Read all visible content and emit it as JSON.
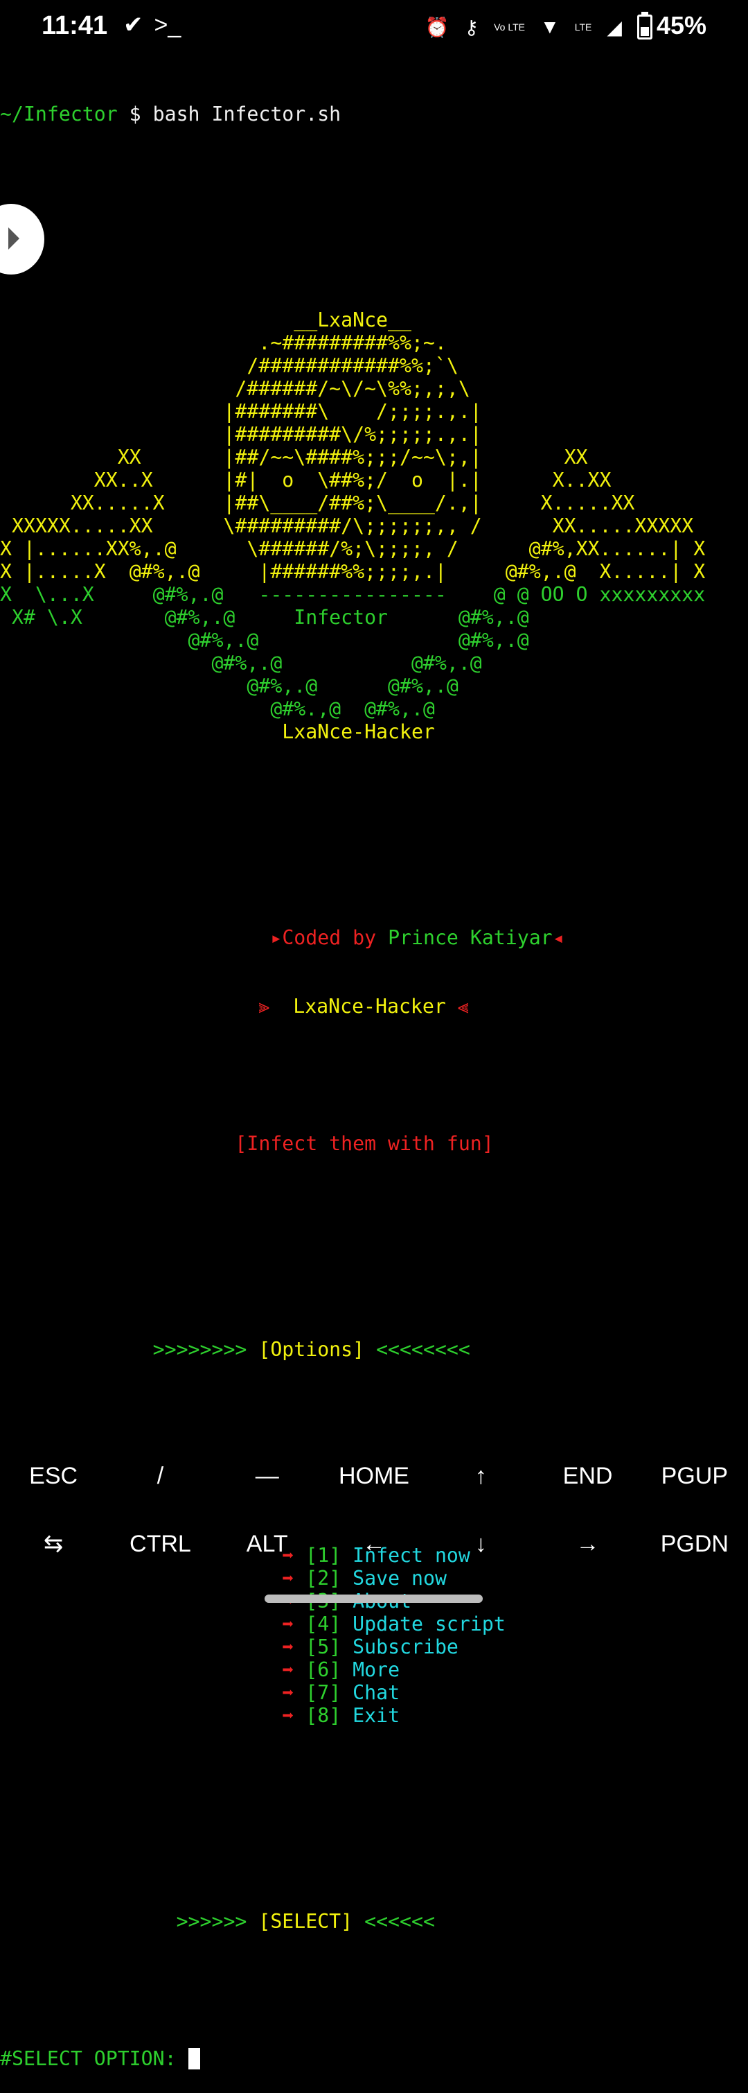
{
  "status_bar": {
    "time": "11:41",
    "left_icons": [
      "check-badge-icon",
      "terminal-prompt-icon"
    ],
    "right_icons": [
      "alarm-icon",
      "key-icon",
      "volte-icon",
      "wifi-icon",
      "lte-signal-icon"
    ],
    "volte_text": "Vo LTE",
    "lte_text": "LTE",
    "battery_percent": "45%",
    "battery_level": 0.45
  },
  "terminal": {
    "prompt_path": "~/Infector",
    "prompt_symbol": " $ ",
    "command": "bash Infector.sh",
    "art": [
      [
        {
          "t": "                         __LxaNce__",
          "c": "y"
        }
      ],
      [
        {
          "t": "                      .~#########%%;~.",
          "c": "y"
        }
      ],
      [
        {
          "t": "                     /############%%;`\\",
          "c": "y"
        }
      ],
      [
        {
          "t": "                    /######/~\\/~\\%%;,;,\\",
          "c": "y"
        }
      ],
      [
        {
          "t": "                   |#######\\    /;;;;.,.|",
          "c": "y"
        }
      ],
      [
        {
          "t": "                   |#########\\/%;;;;;.,.|",
          "c": "y"
        }
      ],
      [
        {
          "t": "          XX       |##/~~\\####%;;;/~~\\;,|       XX",
          "c": "y"
        }
      ],
      [
        {
          "t": "        XX..X      |#|  o  \\##%;/  o  |.|      X..XX",
          "c": "y"
        }
      ],
      [
        {
          "t": "      XX.....X     |##\\____/##%;\\____/.,|     X.....XX",
          "c": "y"
        }
      ],
      [
        {
          "t": " XXXXX.....XX      \\#########/\\;;;;;;,, /      XX.....XXXXX",
          "c": "y"
        }
      ],
      [
        {
          "t": "X |......XX%,.@",
          "c": "y"
        },
        {
          "t": "      \\######/%;\\;;;;, /      ",
          "c": "y"
        },
        {
          "t": "@#%,",
          "c": "y"
        },
        {
          "t": "XX......| X",
          "c": "y"
        }
      ],
      [
        {
          "t": "X |.....X  ",
          "c": "y"
        },
        {
          "t": "@#%,.@",
          "c": "y"
        },
        {
          "t": "     |######%%;;;;,.|     ",
          "c": "y"
        },
        {
          "t": "@#%,.@",
          "c": "y"
        },
        {
          "t": "  X.....| X",
          "c": "y"
        }
      ],
      [
        {
          "t": "X  \\...X     @#%,.@   ----------------    @ @ OO O xxxxxxxxx",
          "c": "g"
        }
      ],
      [
        {
          "t": " X# \\.X       @#%,.@     Infector      @#%,.@",
          "c": "g"
        }
      ],
      [
        {
          "t": "                @#%,.@                 @#%,.@",
          "c": "g"
        }
      ],
      [
        {
          "t": "                  @#%,.@           @#%,.@",
          "c": "g"
        }
      ],
      [
        {
          "t": "                     @#%,.@      @#%,.@",
          "c": "g"
        }
      ],
      [
        {
          "t": "                       @#%.,@  @#%,.@",
          "c": "g"
        }
      ],
      [
        {
          "t": "                        LxaNce-Hacker",
          "c": "y"
        }
      ]
    ],
    "coded_by_label": "Coded by",
    "author": "Prince Katiyar",
    "handle": "LxaNce-Hacker",
    "tagline": "[Infect them with fun]",
    "options_left": ">>>>>>>> ",
    "options_title": "[Options]",
    "options_right": " <<<<<<<<",
    "menu": [
      {
        "num": "[1]",
        "label": "Infect now"
      },
      {
        "num": "[2]",
        "label": "Save now"
      },
      {
        "num": "[3]",
        "label": "About"
      },
      {
        "num": "[4]",
        "label": "Update script"
      },
      {
        "num": "[5]",
        "label": "Subscribe"
      },
      {
        "num": "[6]",
        "label": "More"
      },
      {
        "num": "[7]",
        "label": "Chat"
      },
      {
        "num": "[8]",
        "label": "Exit"
      }
    ],
    "select_left": ">>>>>> ",
    "select_title": "[SELECT]",
    "select_right": " <<<<<<",
    "input_prompt": "#SELECT OPTION: "
  },
  "extra_keys": {
    "row1": [
      "ESC",
      "/",
      "—",
      "HOME",
      "↑",
      "END",
      "PGUP"
    ],
    "row2": [
      "⇆",
      "CTRL",
      "ALT",
      "←",
      "↓",
      "→",
      "PGDN"
    ]
  }
}
